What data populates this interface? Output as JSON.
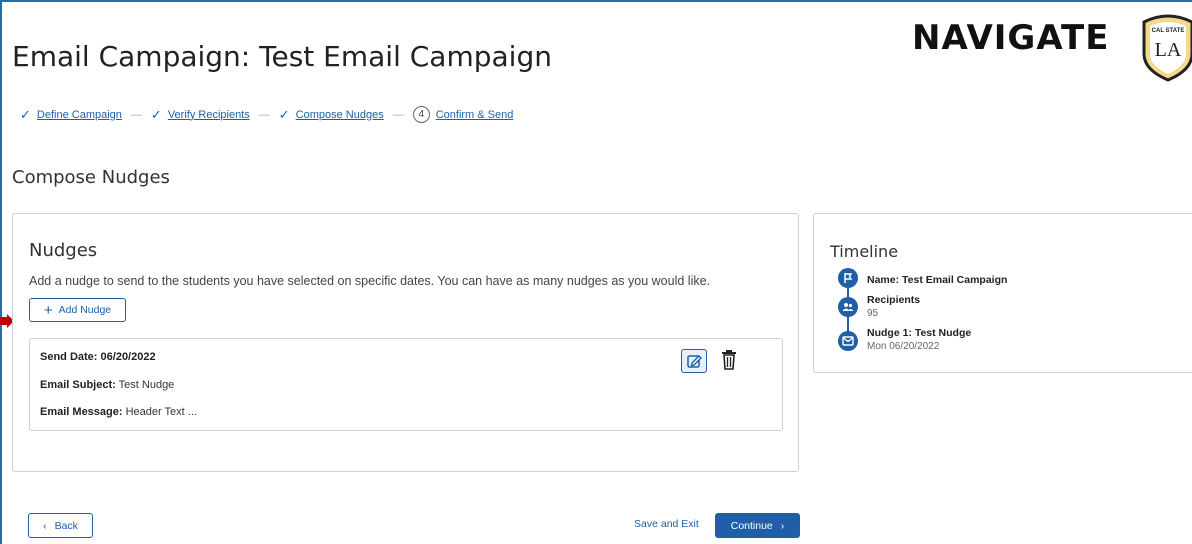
{
  "header": {
    "page_title": "Email Campaign: Test Email Campaign",
    "brand_name": "NAVIGATE",
    "badge": {
      "top_text": "CAL STATE",
      "main_text": "LA"
    }
  },
  "stepper": {
    "steps": [
      {
        "label": "Define Campaign",
        "status": "complete"
      },
      {
        "label": "Verify Recipients",
        "status": "complete"
      },
      {
        "label": "Compose Nudges",
        "status": "complete"
      },
      {
        "label": "Confirm & Send",
        "status": "current",
        "number": "4"
      }
    ],
    "separator": "—"
  },
  "section_title": "Compose Nudges",
  "nudges_panel": {
    "title": "Nudges",
    "description": "Add a nudge to send to the students you have selected on specific dates. You can have as many nudges as you would like.",
    "add_button": "Add Nudge",
    "items": [
      {
        "send_date_label": "Send Date:",
        "send_date": "06/20/2022",
        "subject_label": "Email Subject:",
        "subject": "Test Nudge",
        "message_label": "Email Message:",
        "message": "Header Text ..."
      }
    ]
  },
  "timeline": {
    "title": "Timeline",
    "items": [
      {
        "label": "Name: Test Email Campaign",
        "sub": "",
        "icon": "flag-icon"
      },
      {
        "label": "Recipients",
        "sub": "95",
        "icon": "people-icon"
      },
      {
        "label": "Nudge 1: Test Nudge",
        "sub": "Mon 06/20/2022",
        "icon": "mail-icon"
      }
    ]
  },
  "footer": {
    "back": "Back",
    "save_exit": "Save and Exit",
    "continue": "Continue"
  },
  "colors": {
    "accent": "#1f5fa8",
    "annotation_arrow": "#c00000"
  }
}
